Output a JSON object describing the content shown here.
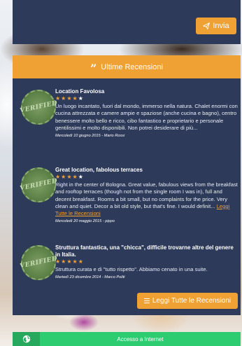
{
  "contact": {
    "send_label": "Invia"
  },
  "reviews": {
    "header": "Ultime Recensioni",
    "badge_text": "VERIFIED",
    "items": [
      {
        "title": "Location Favolosa",
        "rating": 4,
        "text": "Un luogo incantato, fuori dal mondo, immerso nella natura. Chalet enormi con cucina attrezzata e camere ampie e spaziose (anche cucina e bagno), centro benessere molto bello e ricco, cibo fantastico e proprietario e personale gentilissimi e molto disponibili. Non potrei desiderare di più...",
        "link": "",
        "meta": "Mercoledì 10 giugno 2015 - Mario Rossi"
      },
      {
        "title": "Great location, fabolous terraces",
        "rating": 4,
        "text": "Right in the center of Bologna. Great value, fabulous views from the breakfast and rooftop terraces (though not from the single room I was in), full and decent breakfast. Rooms a bit small, but no complaints for the price. Very clean and quiet. Decor a bit old style, but that's fine. I would definit...",
        "link": "Leggi Tutte le Recensioni",
        "meta": "Mercoledì 20 maggio 2015 - pippo"
      },
      {
        "title": "Struttura fantastica, una \"chicca\", difficile trovarne altre del genere in Italia.",
        "rating": 5,
        "text": "Struttura curata e di \"tutto rispetto\". Abbiamo cenato in una suite.",
        "link": "",
        "meta": "Martedì 23 dicembre 2014 - Marco Politi"
      }
    ],
    "all_button": "Leggi Tutte le Recensioni"
  },
  "internet": {
    "label": "Accesso a Internet"
  },
  "colors": {
    "panel": "#2d3a5a",
    "accent": "#f0a134",
    "green": "#2ecc71"
  }
}
